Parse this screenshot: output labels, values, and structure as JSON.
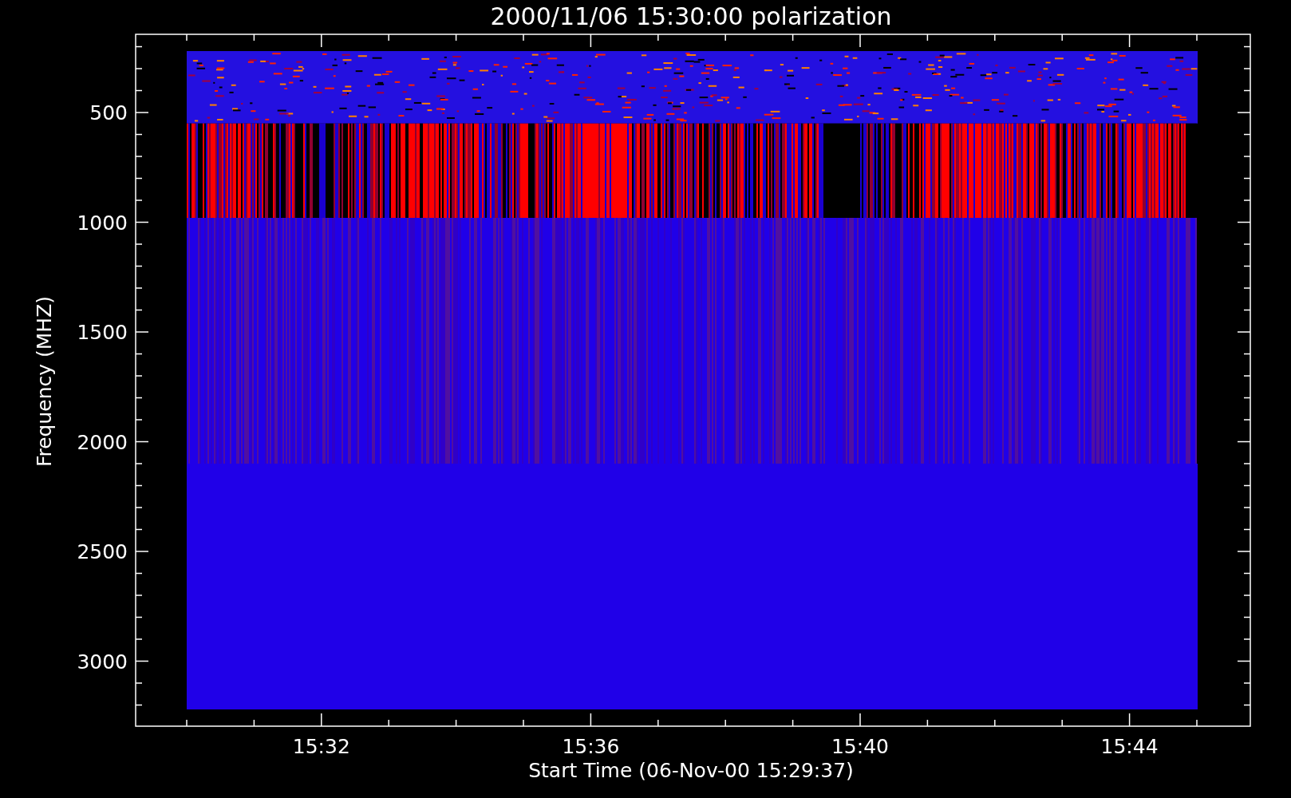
{
  "title": "2000/11/06 15:30:00 polarization",
  "y_axis": {
    "label": "Frequency (MHZ)",
    "ticks": [
      "500",
      "1000",
      "1500",
      "2000",
      "2500",
      "3000"
    ]
  },
  "x_axis": {
    "label": "Start Time (06-Nov-00 15:29:37)",
    "ticks": [
      "15:32",
      "15:36",
      "15:40",
      "15:44"
    ]
  }
}
